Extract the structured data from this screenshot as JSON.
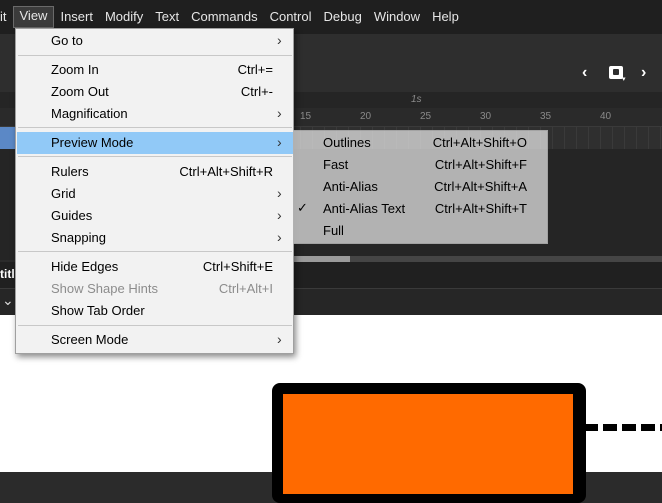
{
  "menubar": {
    "items": [
      "it",
      "View",
      "Insert",
      "Modify",
      "Text",
      "Commands",
      "Control",
      "Debug",
      "Window",
      "Help"
    ]
  },
  "timeline": {
    "ruler_ticks": [
      "15",
      "20",
      "25",
      "30",
      "35",
      "40"
    ],
    "frame_marker": "1s",
    "layer_title_partial": "titl"
  },
  "view_menu": {
    "goto": {
      "label": "Go to"
    },
    "zoom_in": {
      "label": "Zoom In",
      "shortcut": "Ctrl+="
    },
    "zoom_out": {
      "label": "Zoom Out",
      "shortcut": "Ctrl+-"
    },
    "magnification": {
      "label": "Magnification"
    },
    "preview_mode": {
      "label": "Preview Mode"
    },
    "rulers": {
      "label": "Rulers",
      "shortcut": "Ctrl+Alt+Shift+R"
    },
    "grid": {
      "label": "Grid"
    },
    "guides": {
      "label": "Guides"
    },
    "snapping": {
      "label": "Snapping"
    },
    "hide_edges": {
      "label": "Hide Edges",
      "shortcut": "Ctrl+Shift+E"
    },
    "show_shape_hints": {
      "label": "Show Shape Hints",
      "shortcut": "Ctrl+Alt+I"
    },
    "show_tab_order": {
      "label": "Show Tab Order"
    },
    "screen_mode": {
      "label": "Screen Mode"
    }
  },
  "preview_submenu": {
    "outlines": {
      "label": "Outlines",
      "shortcut": "Ctrl+Alt+Shift+O"
    },
    "fast": {
      "label": "Fast",
      "shortcut": "Ctrl+Alt+Shift+F"
    },
    "anti_alias": {
      "label": "Anti-Alias",
      "shortcut": "Ctrl+Alt+Shift+A"
    },
    "anti_alias_text": {
      "label": "Anti-Alias Text",
      "shortcut": "Ctrl+Alt+Shift+T",
      "checked": true
    },
    "full": {
      "label": "Full"
    }
  },
  "icons": {
    "submenu_arrow": "chevron-right-icon",
    "check": "checkmark-icon",
    "back": "chevron-left-icon",
    "forward": "chevron-right-icon",
    "camera": "camera-icon"
  },
  "colors": {
    "menu_highlight": "#91c9f7",
    "shape_fill": "#ff6a00",
    "selected_layer": "#5b88c6"
  }
}
